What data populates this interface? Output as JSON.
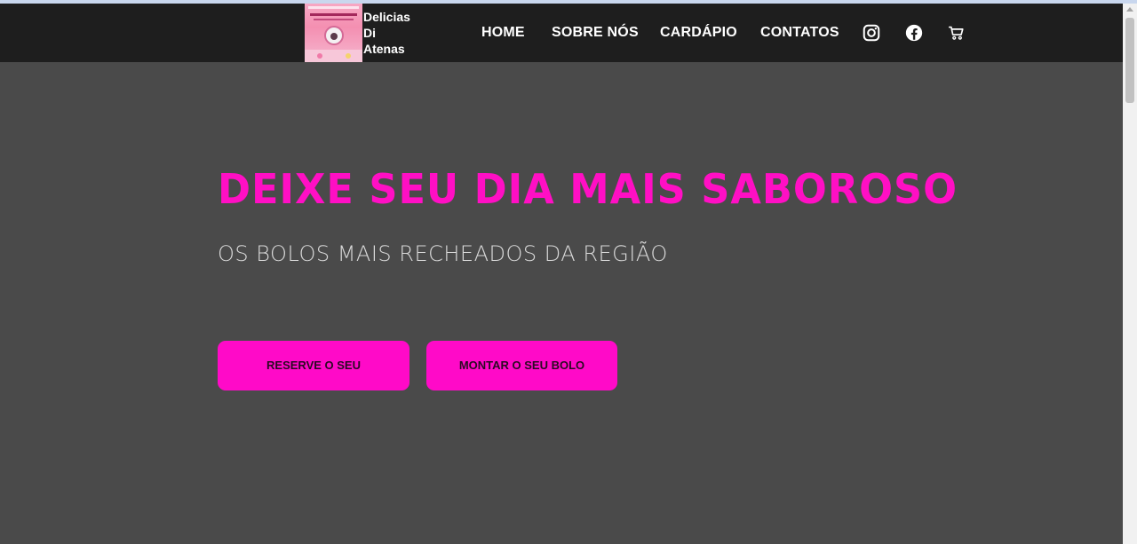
{
  "brand": {
    "name": "Delicias\nDi\nAtenas",
    "logo_alt": "logo-image"
  },
  "nav": {
    "items": [
      {
        "label": "HOME"
      },
      {
        "label": "SOBRE NÓS"
      },
      {
        "label": "CARDÁPIO"
      },
      {
        "label": "CONTATOS"
      }
    ],
    "icons": {
      "instagram": "instagram-icon",
      "facebook": "facebook-icon",
      "cart": "cart-icon"
    }
  },
  "hero": {
    "title": "DEIXE SEU DIA MAIS SABOROSO",
    "subtitle": "OS BOLOS MAIS RECHEADOS DA REGIÃO",
    "buttons": {
      "reserve": "RESERVE O SEU",
      "montar": "MONTAR O SEU BOLO"
    }
  },
  "colors": {
    "accent": "#ff0ac8",
    "title": "#ff0fc4",
    "navbar": "#1e1e1e",
    "background": "#4a4a4a",
    "subtitle": "#d9d9d9"
  }
}
